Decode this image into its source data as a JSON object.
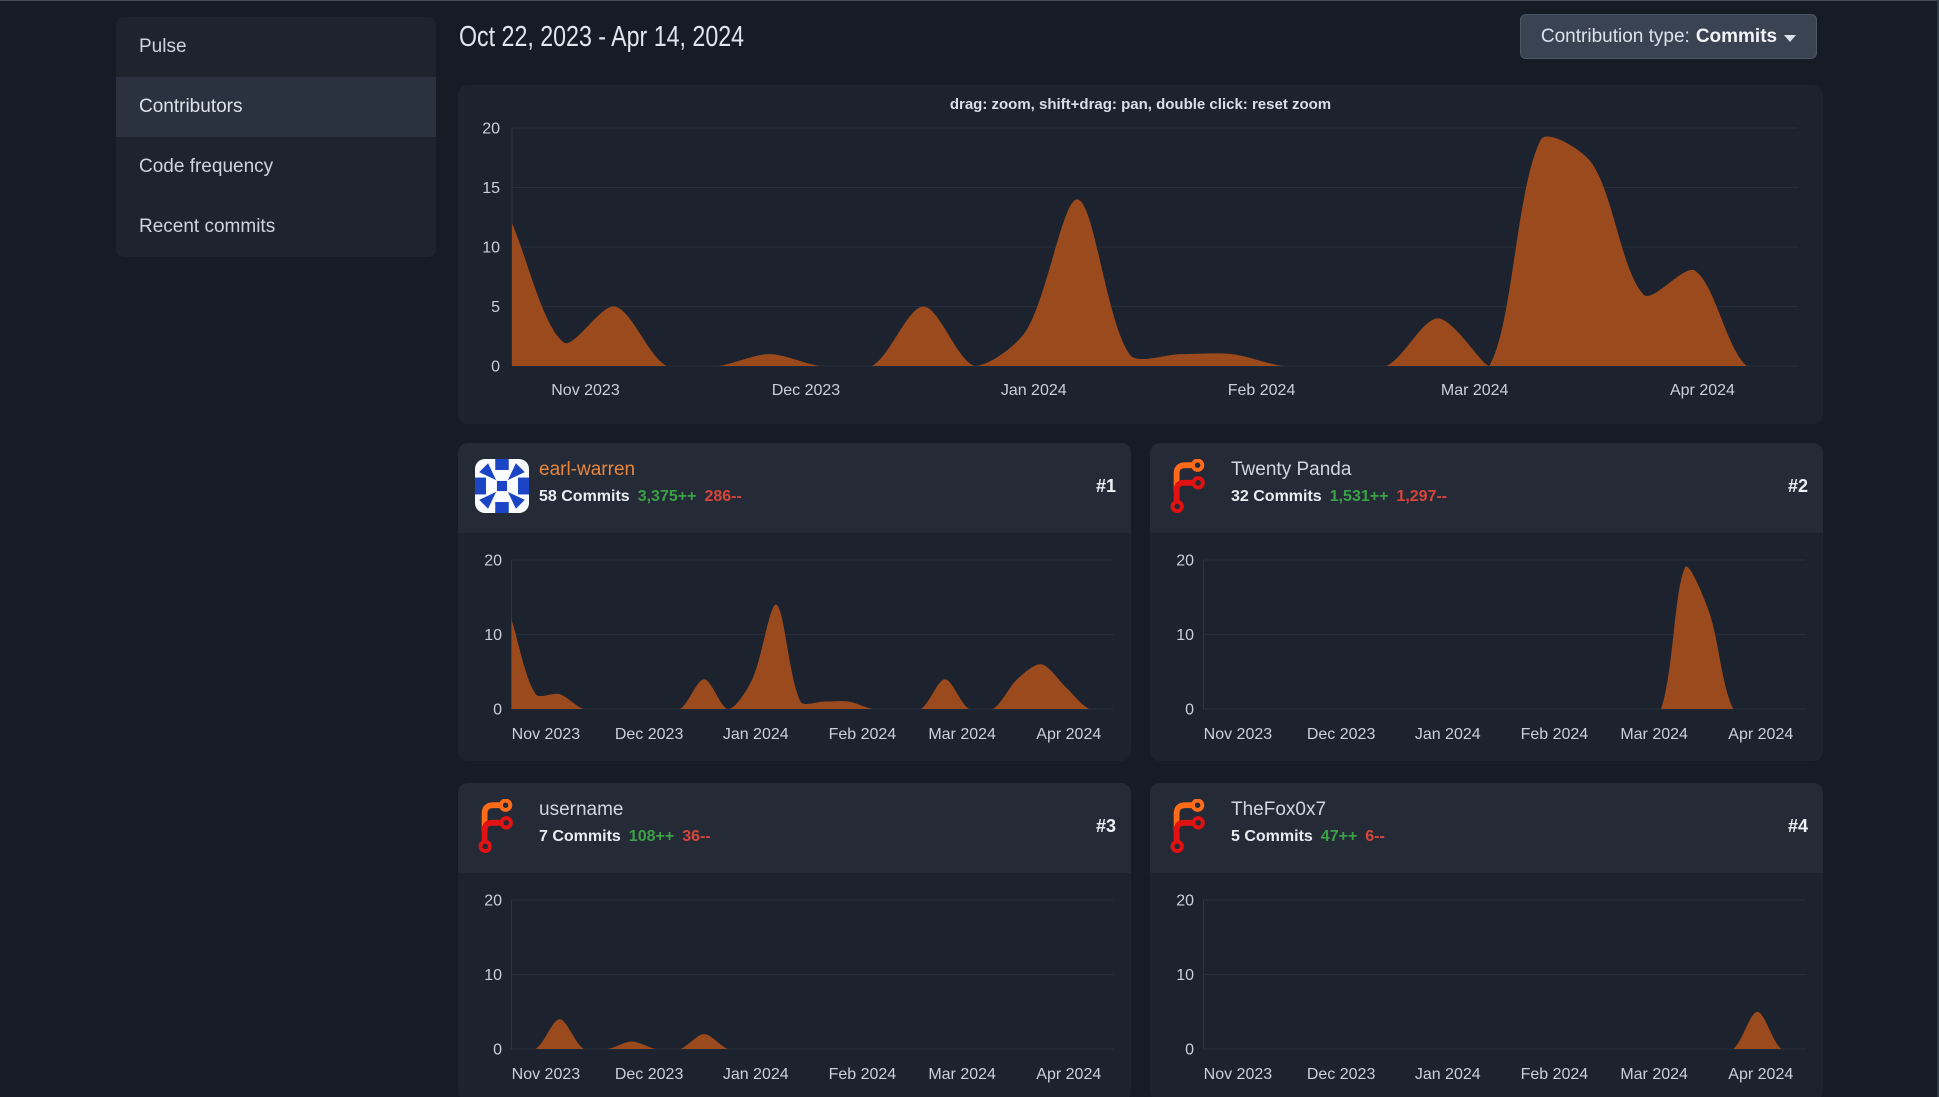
{
  "header": {
    "date_range": "Oct 22, 2023 - Apr 14, 2024",
    "contribution_type_label": "Contribution type:",
    "contribution_type_value": "Commits"
  },
  "sidebar": {
    "items": [
      {
        "label": "Pulse",
        "active": false
      },
      {
        "label": "Contributors",
        "active": true
      },
      {
        "label": "Code frequency",
        "active": false
      },
      {
        "label": "Recent commits",
        "active": false
      }
    ]
  },
  "main_chart": {
    "hint": "drag: zoom, shift+drag: pan, double click: reset zoom"
  },
  "contributors": [
    {
      "name": "earl-warren",
      "rank": "#1",
      "commits": "58 Commits",
      "additions": "3,375++",
      "deletions": "286--",
      "is_link": true,
      "avatar": "identicon"
    },
    {
      "name": "Twenty Panda",
      "rank": "#2",
      "commits": "32 Commits",
      "additions": "1,531++",
      "deletions": "1,297--",
      "is_link": false,
      "avatar": "forgejo-logo"
    },
    {
      "name": "username",
      "rank": "#3",
      "commits": "7 Commits",
      "additions": "108++",
      "deletions": "36--",
      "is_link": false,
      "avatar": "forgejo-logo"
    },
    {
      "name": "TheFox0x7",
      "rank": "#4",
      "commits": "5 Commits",
      "additions": "47++",
      "deletions": "6--",
      "is_link": false,
      "avatar": "forgejo-logo"
    }
  ],
  "chart_data": [
    {
      "id": "total",
      "type": "area",
      "title": "Total commits per week",
      "x_start_date": "2023-10-22",
      "x_end_date": "2024-04-14",
      "x_tick_labels": [
        "Nov 2023",
        "Dec 2023",
        "Jan 2024",
        "Feb 2024",
        "Mar 2024",
        "Apr 2024"
      ],
      "x_tick_day_offsets": [
        10,
        40,
        71,
        102,
        131,
        162
      ],
      "total_days": 175,
      "week_values": [
        12,
        2,
        5,
        0,
        0,
        1,
        0,
        0,
        5,
        0,
        3,
        14,
        1,
        1,
        1,
        0,
        0,
        0,
        4,
        0,
        19,
        17,
        6,
        8,
        0,
        0
      ],
      "ylim": [
        0,
        20
      ],
      "y_ticks": [
        0,
        5,
        10,
        15,
        20
      ],
      "grid": true,
      "legend": "none"
    },
    {
      "id": "earl-warren",
      "type": "area",
      "title": "earl-warren commits per week",
      "x_start_date": "2023-10-22",
      "x_end_date": "2024-04-14",
      "x_tick_labels": [
        "Nov 2023",
        "Dec 2023",
        "Jan 2024",
        "Feb 2024",
        "Mar 2024",
        "Apr 2024"
      ],
      "x_tick_day_offsets": [
        10,
        40,
        71,
        102,
        131,
        162
      ],
      "total_days": 175,
      "week_values": [
        12,
        2,
        2,
        0,
        0,
        0,
        0,
        0,
        4,
        0,
        4,
        14,
        1,
        1,
        1,
        0,
        0,
        0,
        4,
        0,
        0,
        4,
        6,
        3,
        0,
        0
      ],
      "ylim": [
        0,
        20
      ],
      "y_ticks": [
        0,
        10,
        20
      ],
      "grid": true,
      "legend": "none"
    },
    {
      "id": "twenty-panda",
      "type": "area",
      "title": "Twenty Panda commits per week",
      "x_start_date": "2023-10-22",
      "x_end_date": "2024-04-14",
      "x_tick_labels": [
        "Nov 2023",
        "Dec 2023",
        "Jan 2024",
        "Feb 2024",
        "Mar 2024",
        "Apr 2024"
      ],
      "x_tick_day_offsets": [
        10,
        40,
        71,
        102,
        131,
        162
      ],
      "total_days": 175,
      "week_values": [
        0,
        0,
        0,
        0,
        0,
        0,
        0,
        0,
        0,
        0,
        0,
        0,
        0,
        0,
        0,
        0,
        0,
        0,
        0,
        0,
        19,
        13,
        0,
        0,
        0,
        0
      ],
      "ylim": [
        0,
        20
      ],
      "y_ticks": [
        0,
        10,
        20
      ],
      "grid": true,
      "legend": "none"
    },
    {
      "id": "username",
      "type": "area",
      "title": "username commits per week",
      "x_start_date": "2023-10-22",
      "x_end_date": "2024-04-14",
      "x_tick_labels": [
        "Nov 2023",
        "Dec 2023",
        "Jan 2024",
        "Feb 2024",
        "Mar 2024",
        "Apr 2024"
      ],
      "x_tick_day_offsets": [
        10,
        40,
        71,
        102,
        131,
        162
      ],
      "total_days": 175,
      "week_values": [
        0,
        0,
        4,
        0,
        0,
        1,
        0,
        0,
        2,
        0,
        0,
        0,
        0,
        0,
        0,
        0,
        0,
        0,
        0,
        0,
        0,
        0,
        0,
        0,
        0,
        0
      ],
      "ylim": [
        0,
        20
      ],
      "y_ticks": [
        0,
        10,
        20
      ],
      "grid": true,
      "legend": "none"
    },
    {
      "id": "thefox0x7",
      "type": "area",
      "title": "TheFox0x7 commits per week",
      "x_start_date": "2023-10-22",
      "x_end_date": "2024-04-14",
      "x_tick_labels": [
        "Nov 2023",
        "Dec 2023",
        "Jan 2024",
        "Feb 2024",
        "Mar 2024",
        "Apr 2024"
      ],
      "x_tick_day_offsets": [
        10,
        40,
        71,
        102,
        131,
        162
      ],
      "total_days": 175,
      "week_values": [
        0,
        0,
        0,
        0,
        0,
        0,
        0,
        0,
        0,
        0,
        0,
        0,
        0,
        0,
        0,
        0,
        0,
        0,
        0,
        0,
        0,
        0,
        0,
        5,
        0,
        0
      ],
      "ylim": [
        0,
        20
      ],
      "y_ticks": [
        0,
        10,
        20
      ],
      "grid": true,
      "legend": "none"
    }
  ],
  "colors": {
    "page_bg": "#161c26",
    "card_bg": "#1c232e",
    "card_header_bg": "#242b37",
    "menu_bg": "#1d242e",
    "menu_active_bg": "#2a323f",
    "area_fill": "#9a4a1c",
    "grid_line": "#282f3a",
    "axis_line": "#2e3642",
    "tick_text": "#c9d0d9",
    "link_orange": "#e8863d",
    "additions_green": "#3aa147",
    "deletions_red": "#d8453a"
  }
}
